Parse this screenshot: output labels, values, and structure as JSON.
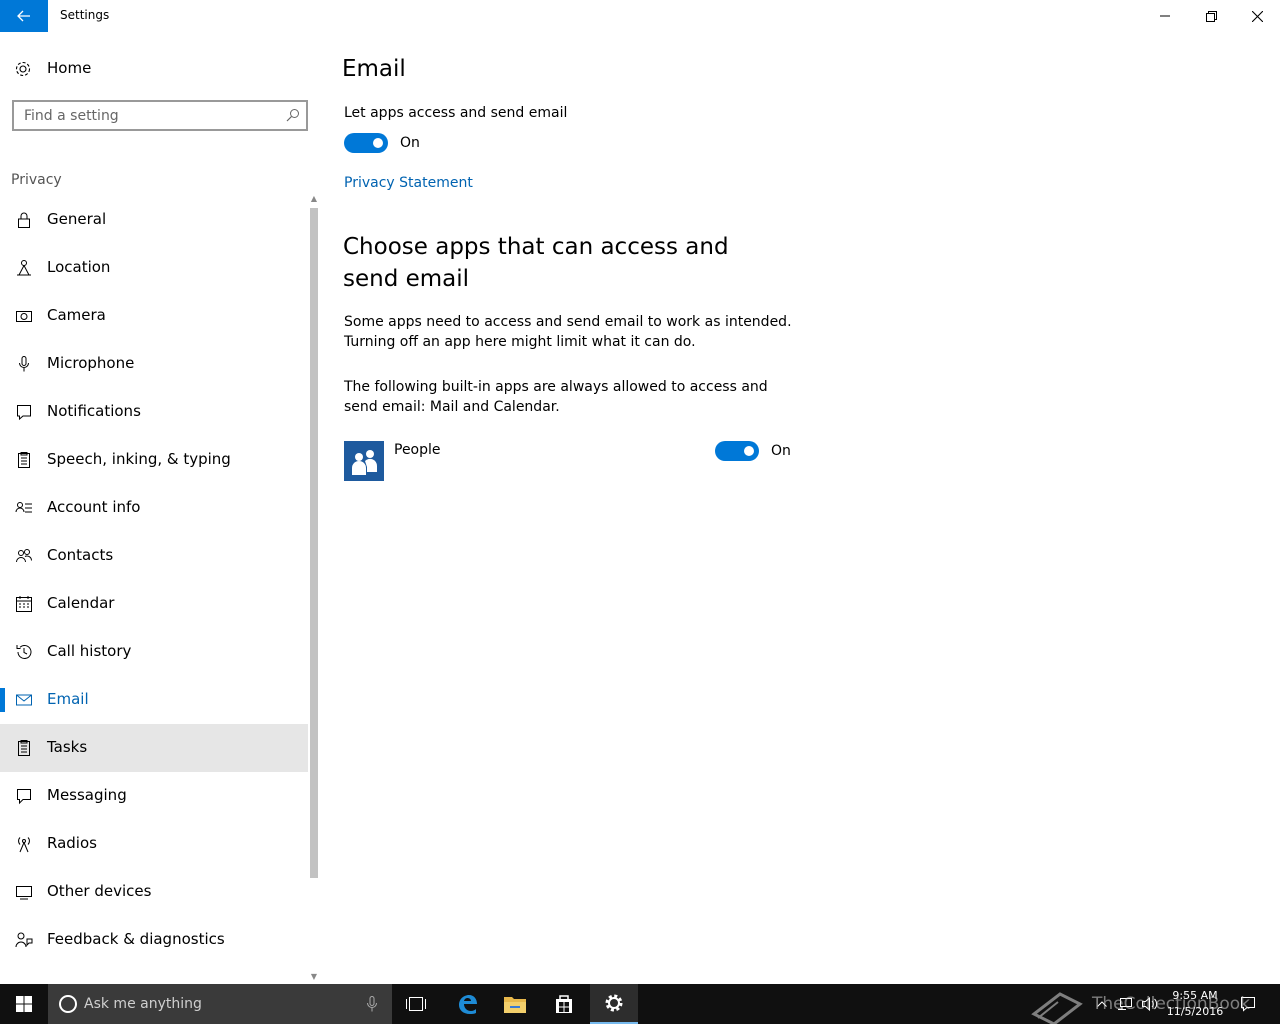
{
  "window": {
    "title": "Settings",
    "controls": {
      "minimize": "minimize-icon",
      "maximize": "restore-icon",
      "close": "close-icon"
    }
  },
  "sidebar": {
    "home_label": "Home",
    "search_placeholder": "Find a setting",
    "section_label": "Privacy",
    "items": [
      {
        "label": "General",
        "icon": "lock-icon"
      },
      {
        "label": "Location",
        "icon": "location-icon"
      },
      {
        "label": "Camera",
        "icon": "camera-icon"
      },
      {
        "label": "Microphone",
        "icon": "microphone-icon"
      },
      {
        "label": "Notifications",
        "icon": "notifications-icon"
      },
      {
        "label": "Speech, inking, & typing",
        "icon": "speech-icon"
      },
      {
        "label": "Account info",
        "icon": "account-info-icon"
      },
      {
        "label": "Contacts",
        "icon": "contacts-icon"
      },
      {
        "label": "Calendar",
        "icon": "calendar-icon"
      },
      {
        "label": "Call history",
        "icon": "call-history-icon"
      },
      {
        "label": "Email",
        "icon": "email-icon",
        "selected": true
      },
      {
        "label": "Tasks",
        "icon": "tasks-icon",
        "hovered": true
      },
      {
        "label": "Messaging",
        "icon": "messaging-icon"
      },
      {
        "label": "Radios",
        "icon": "radios-icon"
      },
      {
        "label": "Other devices",
        "icon": "other-devices-icon"
      },
      {
        "label": "Feedback & diagnostics",
        "icon": "feedback-icon"
      }
    ]
  },
  "main": {
    "title": "Email",
    "master_setting": {
      "label": "Let apps access and send email",
      "state": "On"
    },
    "privacy_link": "Privacy Statement",
    "subheading": "Choose apps that can access and send email",
    "description": "Some apps need to access and send email to work as intended. Turning off an app here might limit what it can do.",
    "builtin_note": "The following built-in apps are always allowed to access and send email: Mail and Calendar.",
    "apps": [
      {
        "name": "People",
        "state": "On"
      }
    ]
  },
  "taskbar": {
    "search_placeholder": "Ask me anything",
    "time": "9:55 AM",
    "date": "11/5/2016"
  },
  "watermark": "TheCollectionBook",
  "colors": {
    "accent": "#0078d7",
    "link": "#0063b1",
    "taskbar": "#101010"
  }
}
